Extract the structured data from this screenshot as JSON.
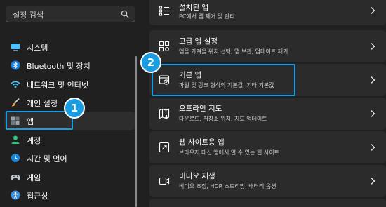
{
  "search": {
    "placeholder": "설정 검색",
    "icon": "search-icon"
  },
  "sidebar": {
    "items": [
      {
        "label": "시스템",
        "icon": "monitor-icon"
      },
      {
        "label": "Bluetooth 및 장치",
        "icon": "bluetooth-icon"
      },
      {
        "label": "네트워크 및 인터넷",
        "icon": "wifi-icon"
      },
      {
        "label": "개인 설정",
        "icon": "brush-icon"
      },
      {
        "label": "앱",
        "icon": "apps-icon",
        "active": true
      },
      {
        "label": "계정",
        "icon": "person-icon"
      },
      {
        "label": "시간 및 언어",
        "icon": "globe-clock-icon"
      },
      {
        "label": "게임",
        "icon": "gamepad-icon"
      },
      {
        "label": "접근성",
        "icon": "accessibility-icon"
      }
    ]
  },
  "cards": [
    {
      "title": "설치된 앱",
      "desc": "PC에서 앱 제거 및 관리",
      "icon": "installed-apps-icon"
    },
    {
      "title": "고급 앱 설정",
      "desc": "앱을 가져올 위치 선택, 앱 보관, 업데이트 제거",
      "icon": "advanced-apps-icon"
    },
    {
      "title": "기본 앱",
      "desc": "파일 및 링크 형식의 기본값, 기타 기본값",
      "icon": "default-apps-icon"
    },
    {
      "title": "오프라인 지도",
      "desc": "다운로드, 저장소 위치, 지도 업데이트",
      "icon": "offline-maps-icon"
    },
    {
      "title": "웹 사이트용 앱",
      "desc": "브라우저 대신 앱에서 열 수 있는 웹 사이트",
      "icon": "web-apps-icon"
    },
    {
      "title": "비디오 재생",
      "desc": "비디오 조정, HDR 스트리밍, 배터리 옵션",
      "icon": "video-icon"
    }
  ],
  "callouts": [
    {
      "number": "1"
    },
    {
      "number": "2"
    }
  ],
  "colors": {
    "accent": "#1a9ce2",
    "background": "#202020",
    "card": "#2b2b2b"
  }
}
